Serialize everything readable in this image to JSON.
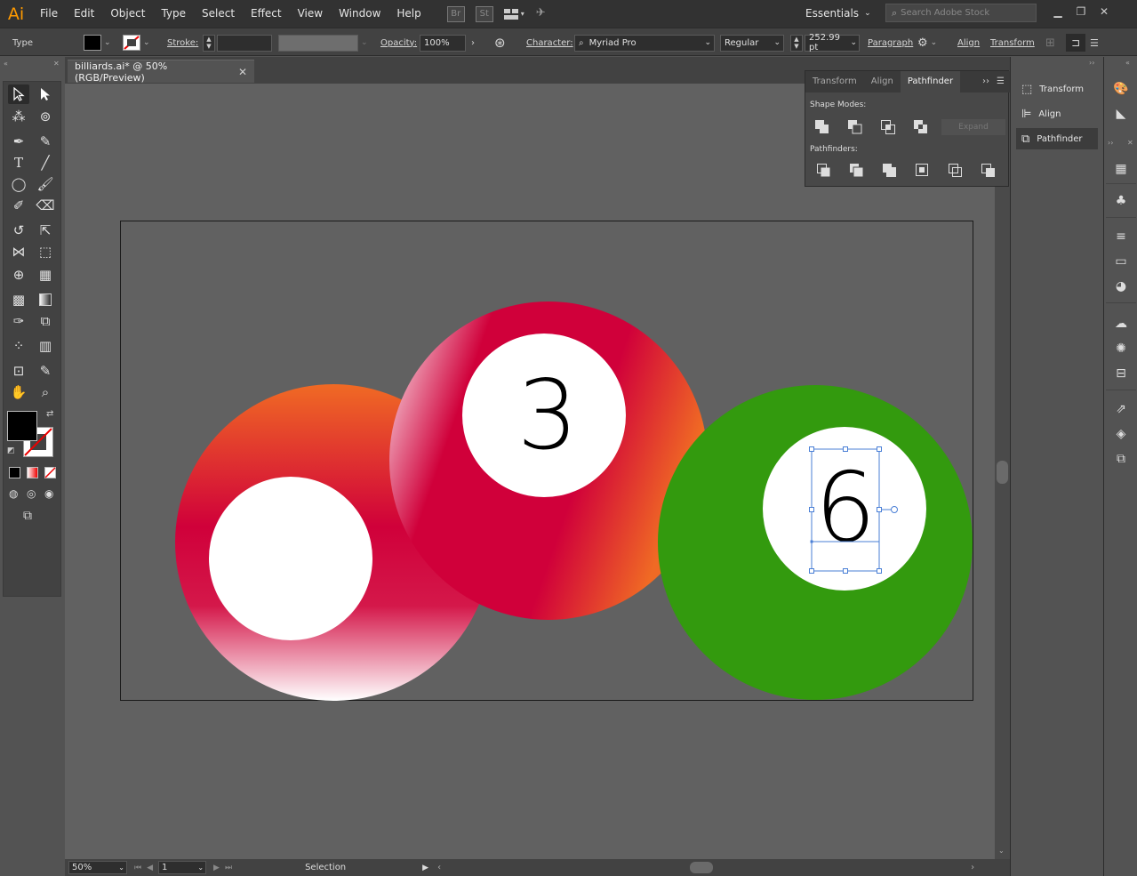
{
  "app": {
    "logo": "Ai",
    "bridge": "Br",
    "stock": "St"
  },
  "menu": [
    "File",
    "Edit",
    "Object",
    "Type",
    "Select",
    "Effect",
    "View",
    "Window",
    "Help"
  ],
  "workspace": "Essentials",
  "stock_search_placeholder": "Search Adobe Stock",
  "controlbar": {
    "type_label": "Type",
    "stroke_label": "Stroke:",
    "opacity_label": "Opacity:",
    "opacity_value": "100%",
    "character_label": "Character:",
    "font_name": "Myriad Pro",
    "font_style": "Regular",
    "font_size": "252.99 pt",
    "paragraph_label": "Paragraph",
    "align_label": "Align",
    "transform_label": "Transform"
  },
  "document": {
    "tab_title": "billiards.ai* @ 50% (RGB/Preview)"
  },
  "pathfinder_panel": {
    "tabs": [
      "Transform",
      "Align",
      "Pathfinder"
    ],
    "active_tab": "Pathfinder",
    "shape_modes_label": "Shape Modes:",
    "expand_label": "Expand",
    "pathfinders_label": "Pathfinders:"
  },
  "dock": {
    "items": [
      "Transform",
      "Align",
      "Pathfinder"
    ],
    "active": "Pathfinder"
  },
  "artwork": {
    "ball_3_number": "3",
    "ball_6_number": "6"
  },
  "colors": {
    "ball_green": "#339a0e",
    "ball_red": "#d0003a",
    "ball_orange": "#f06a24",
    "accent_logo": "#ff9a00"
  },
  "statusbar": {
    "zoom": "50%",
    "artboard_number": "1",
    "status_text": "Selection"
  }
}
